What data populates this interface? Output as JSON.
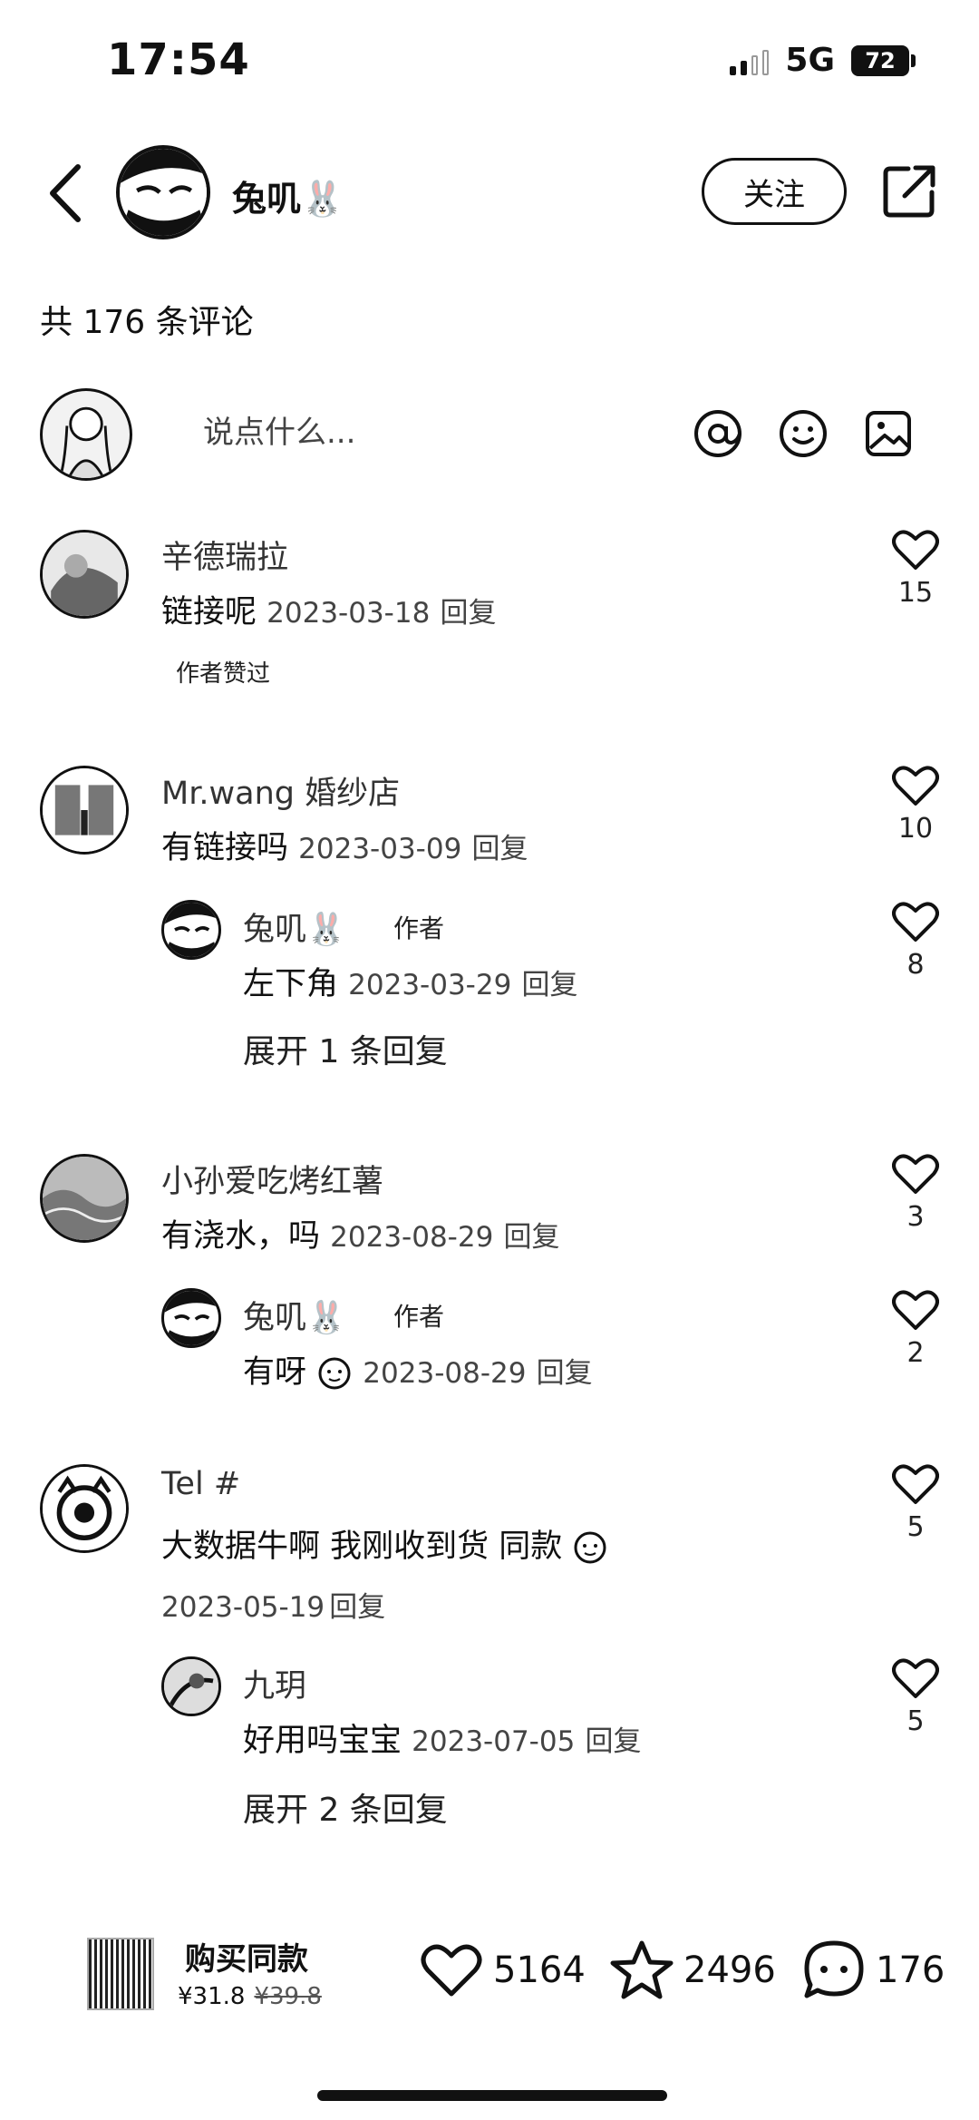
{
  "status_bar": {
    "time": "17:54",
    "network": "5G",
    "battery": "72"
  },
  "header": {
    "author_name": "兔叽🐰",
    "follow_label": "关注"
  },
  "comment_count_label": "共 176 条评论",
  "composer": {
    "placeholder": "说点什么..."
  },
  "comments": [
    {
      "name": "辛德瑞拉",
      "text": "链接呢",
      "date": "2023-03-18",
      "reply_label": "回复",
      "likes": "15",
      "badge": "作者赞过"
    },
    {
      "name": "Mr.wang 婚纱店",
      "text": "有链接吗",
      "date": "2023-03-09",
      "reply_label": "回复",
      "likes": "10",
      "reply": {
        "name": "兔叽🐰",
        "tag": "作者",
        "text": "左下角",
        "date": "2023-03-29",
        "reply_label": "回复",
        "likes": "8"
      },
      "expand": "展开 1 条回复"
    },
    {
      "name": "小孙爱吃烤红薯",
      "text": "有浇水，吗",
      "date": "2023-08-29",
      "reply_label": "回复",
      "likes": "3",
      "reply": {
        "name": "兔叽🐰",
        "tag": "作者",
        "text": "有呀",
        "date": "2023-08-29",
        "reply_label": "回复",
        "likes": "2"
      }
    },
    {
      "name": "Tel #",
      "text": "大数据牛啊  我刚收到货 同款",
      "date": "2023-05-19",
      "reply_label": "回复",
      "likes": "5",
      "reply": {
        "name": "九玥",
        "text": "好用吗宝宝",
        "date": "2023-07-05",
        "reply_label": "回复",
        "likes": "5"
      },
      "expand": "展开 2 条回复"
    }
  ],
  "bottom_bar": {
    "product_title": "购买同款",
    "price": "¥31.8",
    "original_price": "¥39.8",
    "likes": "5164",
    "stars": "2496",
    "comments": "176"
  }
}
